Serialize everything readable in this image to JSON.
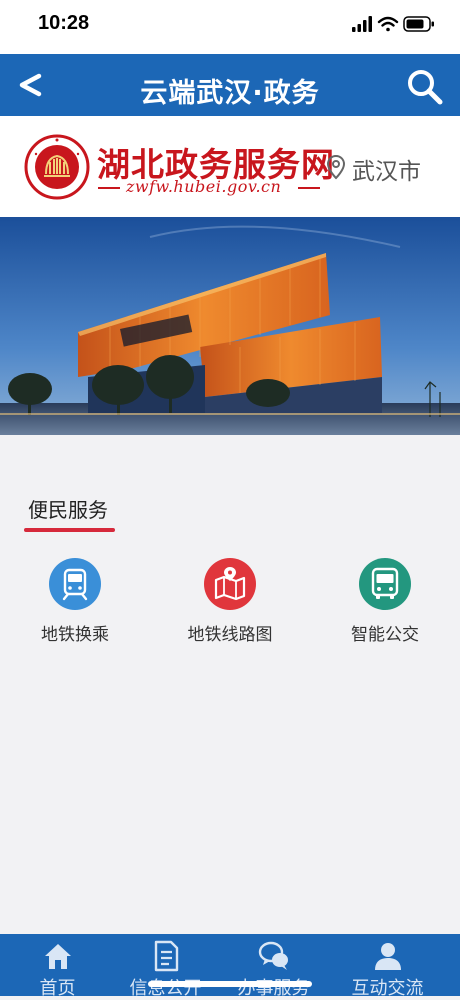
{
  "status_bar": {
    "time": "10:28"
  },
  "nav": {
    "title": "云端武汉·政务",
    "back_icon": "chevron-left-icon",
    "search_icon": "search-icon"
  },
  "brand": {
    "name": "湖北政务服务网",
    "url": "zwfw.hubei.gov.cn",
    "city": "武汉市",
    "colors": {
      "brand_red": "#c8161d"
    }
  },
  "section": {
    "title": "便民服务",
    "accent": "#d6293b",
    "items": [
      {
        "label": "地铁换乘",
        "icon": "metro-train-icon",
        "color": "#3a8fd8"
      },
      {
        "label": "地铁线路图",
        "icon": "route-map-icon",
        "color": "#e0363c"
      },
      {
        "label": "智能公交",
        "icon": "bus-icon",
        "color": "#23977f"
      }
    ]
  },
  "tabs": [
    {
      "label": "首页",
      "icon": "home-icon"
    },
    {
      "label": "信息公开",
      "icon": "document-icon"
    },
    {
      "label": "办事服务",
      "icon": "chat-bubbles-icon"
    },
    {
      "label": "互动交流",
      "icon": "person-icon"
    }
  ],
  "colors": {
    "primary": "#1c67b6",
    "background": "#f2f2f4"
  }
}
